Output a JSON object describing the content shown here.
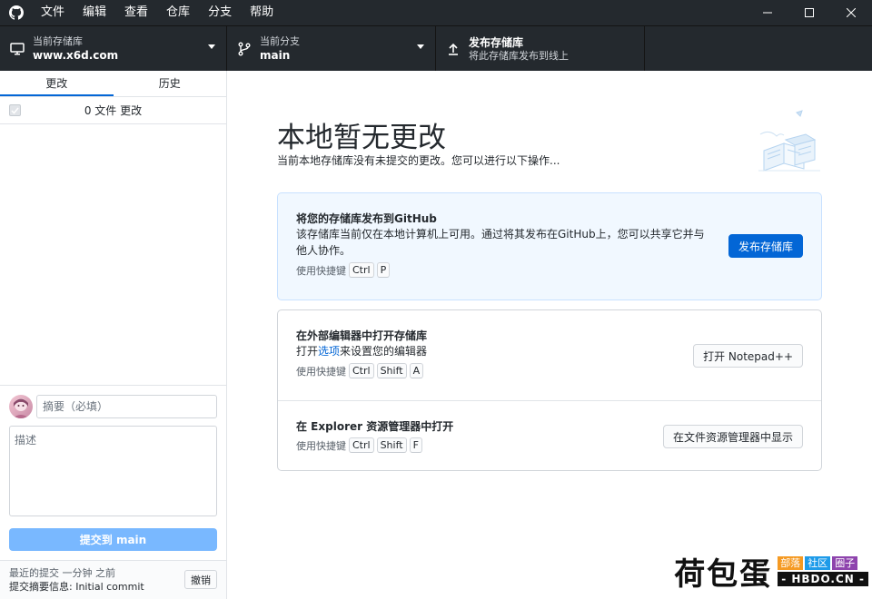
{
  "menu": [
    "文件",
    "编辑",
    "查看",
    "仓库",
    "分支",
    "帮助"
  ],
  "toolbar": {
    "repo": {
      "label": "当前存储库",
      "value": "www.x6d.com"
    },
    "branch": {
      "label": "当前分支",
      "value": "main"
    },
    "publish": {
      "label": "发布存储库",
      "value": "将此存储库发布到线上"
    }
  },
  "sidebar": {
    "tabs": [
      "更改",
      "历史"
    ],
    "changes_count": "0 文件 更改",
    "summary_placeholder": "摘要（必填）",
    "description_placeholder": "描述",
    "commit_button": "提交到 main",
    "last_commit": {
      "line1": "最近的提交 一分钟 之前",
      "line2": "提交摘要信息: Initial commit",
      "undo": "撤销"
    }
  },
  "main": {
    "heading": "本地暂无更改",
    "subheading": "当前本地存储库没有未提交的更改。您可以进行以下操作...",
    "publish_card": {
      "title": "将您的存储库发布到GitHub",
      "desc": "该存储库当前仅在本地计算机上可用。通过将其发布在GitHub上，您可以共享它并与他人协作。",
      "shortcut_label": "使用快捷键",
      "keys": [
        "Ctrl",
        "P"
      ],
      "button": "发布存储库"
    },
    "editor_card": {
      "title": "在外部编辑器中打开存储库",
      "desc_pre": "打开",
      "desc_link": "选项",
      "desc_post": "来设置您的编辑器",
      "shortcut_label": "使用快捷键",
      "keys": [
        "Ctrl",
        "Shift",
        "A"
      ],
      "button": "打开 Notepad++"
    },
    "explorer_card": {
      "title": "在 Explorer 资源管理器中打开",
      "shortcut_label": "使用快捷键",
      "keys": [
        "Ctrl",
        "Shift",
        "F"
      ],
      "button": "在文件资源管理器中显示"
    }
  },
  "watermark": {
    "main": "荷包蛋",
    "tags": [
      {
        "text": "部落",
        "color": "#f59a23"
      },
      {
        "text": "社区",
        "color": "#1e9be9"
      },
      {
        "text": "圈子",
        "color": "#8e44ad"
      }
    ],
    "domain": "- HBDO.CN -"
  }
}
